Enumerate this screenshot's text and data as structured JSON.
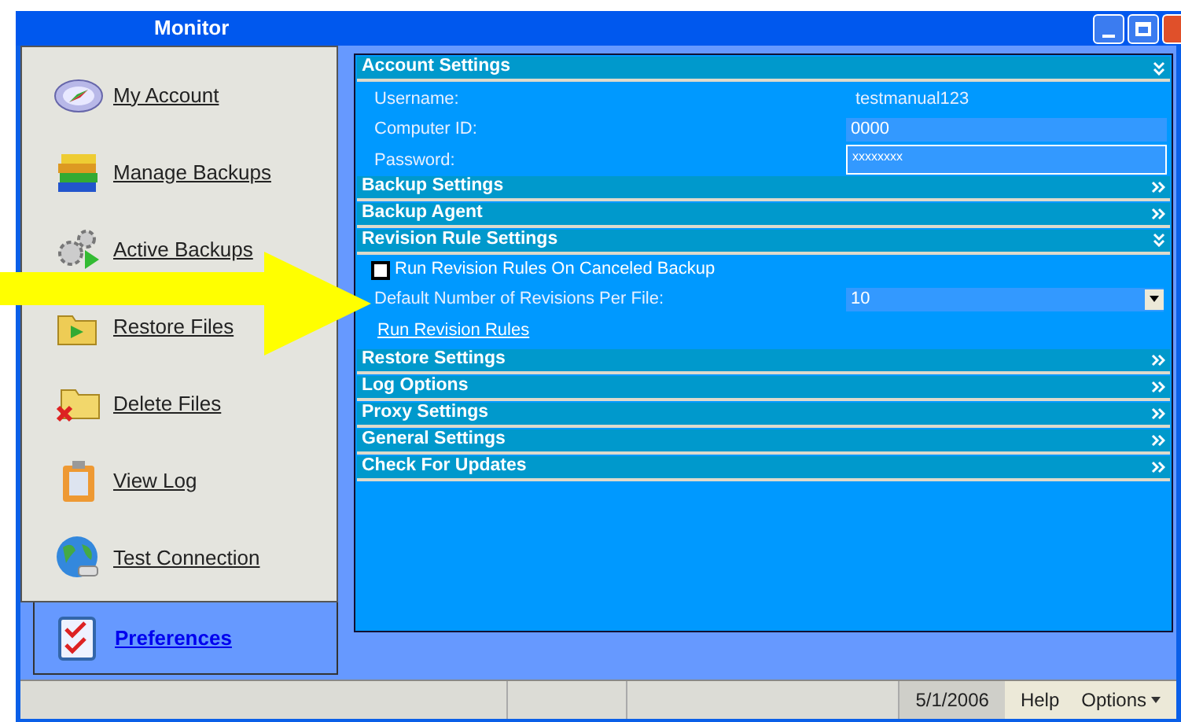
{
  "window": {
    "title": "Monitor"
  },
  "sidebar": {
    "items": [
      {
        "label": "My Account",
        "selected": false
      },
      {
        "label": "Manage Backups",
        "selected": false
      },
      {
        "label": "Active Backups",
        "selected": false
      },
      {
        "label": "Restore Files",
        "selected": false
      },
      {
        "label": "Delete Files",
        "selected": false
      },
      {
        "label": "View Log",
        "selected": false
      },
      {
        "label": "Test Connection",
        "selected": false
      },
      {
        "label": "Preferences",
        "selected": true
      }
    ]
  },
  "sections": [
    {
      "title": "Account Settings",
      "expanded": true,
      "rows": [
        {
          "kind": "text",
          "label": "Username:",
          "value": "testmanual123"
        },
        {
          "kind": "input",
          "label": "Computer ID:",
          "value": "0000"
        },
        {
          "kind": "password",
          "label": "Password:",
          "value": "xxxxxxxx"
        }
      ]
    },
    {
      "title": "Backup Settings",
      "expanded": false
    },
    {
      "title": "Backup Agent",
      "expanded": false
    },
    {
      "title": "Revision Rule Settings",
      "expanded": true,
      "rows": [
        {
          "kind": "checkbox",
          "label": "Run Revision Rules On Canceled Backup",
          "checked": false
        },
        {
          "kind": "select",
          "label": "Default Number of Revisions Per File:",
          "value": "10"
        },
        {
          "kind": "link",
          "label": "Run Revision Rules"
        }
      ]
    },
    {
      "title": "Restore Settings",
      "expanded": false
    },
    {
      "title": "Log Options",
      "expanded": false
    },
    {
      "title": "Proxy Settings",
      "expanded": false
    },
    {
      "title": "General Settings",
      "expanded": false
    },
    {
      "title": "Check For Updates",
      "expanded": false
    }
  ],
  "status_bar": {
    "date": "5/1/2006",
    "menus": [
      "Help",
      "Options"
    ]
  }
}
